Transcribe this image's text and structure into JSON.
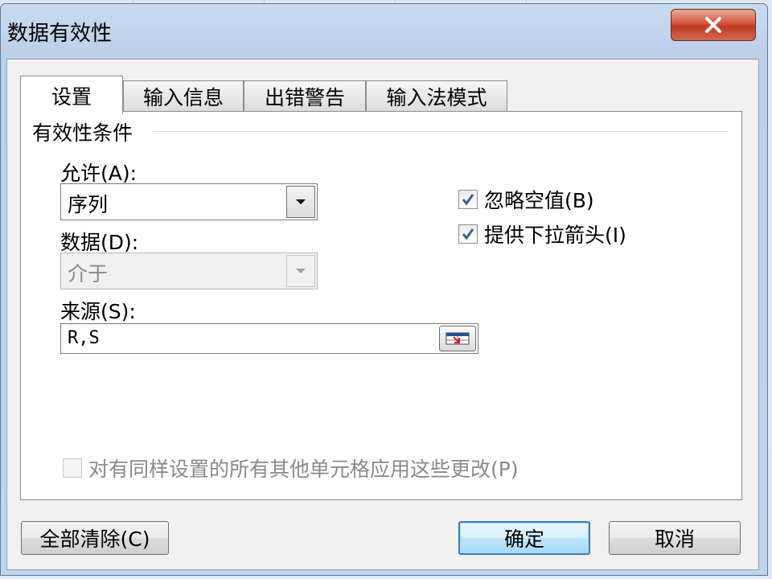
{
  "window": {
    "title": "数据有效性",
    "close_label": "X"
  },
  "tabs": [
    {
      "label": "设置",
      "active": true
    },
    {
      "label": "输入信息",
      "active": false
    },
    {
      "label": "出错警告",
      "active": false
    },
    {
      "label": "输入法模式",
      "active": false
    }
  ],
  "settings": {
    "group_title": "有效性条件",
    "allow_label": "允许(A):",
    "allow_value": "序列",
    "data_label": "数据(D):",
    "data_value": "介于",
    "source_label": "来源(S):",
    "source_value": "R,S",
    "ignore_blank_label": "忽略空值(B)",
    "ignore_blank_checked": true,
    "dropdown_label": "提供下拉箭头(I)",
    "dropdown_checked": true,
    "apply_all_label": "对有同样设置的所有其他单元格应用这些更改(P)",
    "apply_all_checked": false
  },
  "buttons": {
    "clear_all": "全部清除(C)",
    "ok": "确定",
    "cancel": "取消"
  },
  "icons": {
    "close": "close-icon",
    "dropdown": "chevron-down-icon",
    "checkmark": "checkmark-icon",
    "range_select": "range-select-icon"
  },
  "colors": {
    "close_button": "#c9442c",
    "default_button_border": "#3c7fb1",
    "checkmark": "#3a5f8f"
  }
}
